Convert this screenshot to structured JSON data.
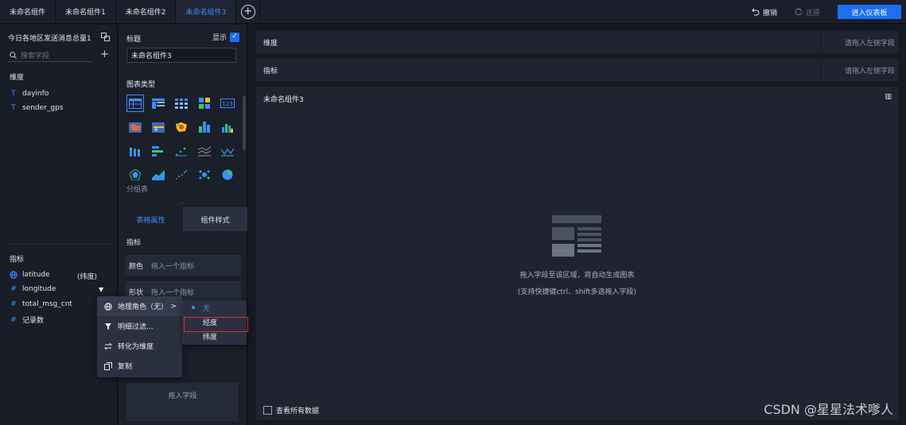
{
  "tabs": [
    {
      "label": "未命名组件"
    },
    {
      "label": "未命名组件1"
    },
    {
      "label": "未命名组件2"
    },
    {
      "label": "未命名组件3"
    }
  ],
  "toolbar": {
    "undo_label": "撤销",
    "redo_label": "还原",
    "enter_dashboard_label": "进入仪表板"
  },
  "left_panel": {
    "dataset_name": "今日各地区发送消息总量1",
    "search_placeholder": "搜索字段",
    "dimensions_title": "维度",
    "dimensions": [
      {
        "icon": "T",
        "name": "dayinfo"
      },
      {
        "icon": "T",
        "name": "sender_gps"
      }
    ],
    "measures_title": "指标",
    "measures": [
      {
        "icon": "globe",
        "name": "latitude",
        "suffix": "(纬度)"
      },
      {
        "icon": "#",
        "name": "longitude"
      },
      {
        "icon": "#",
        "name": "total_msg_cnt"
      },
      {
        "icon": "#",
        "name": "记录数"
      }
    ]
  },
  "middle_panel": {
    "title_label": "标题",
    "show_label": "显示",
    "title_value": "未命名组件3",
    "chart_type_label": "图表类型",
    "selected_chart_caption": "分组表",
    "subtab_table_props": "表格属性",
    "subtab_component_style": "组件样式",
    "measures_label": "指标",
    "color_label": "颜色",
    "color_hint": "拖入一个指标",
    "shape_label": "形状",
    "shape_hint": "拖入一个指标",
    "drop_field_label": "拖入字段"
  },
  "context_menu": {
    "items": [
      {
        "icon": "globe-icon",
        "label": "地理角色（无）"
      },
      {
        "icon": "filter-icon",
        "label": "明细过滤..."
      },
      {
        "icon": "swap-icon",
        "label": "转化为维度"
      },
      {
        "icon": "copy-icon",
        "label": "复制"
      }
    ],
    "submenu": [
      {
        "label": "无"
      },
      {
        "label": "经度"
      },
      {
        "label": "纬度"
      }
    ]
  },
  "canvas": {
    "dimension_slot_label": "维度",
    "dimension_slot_hint": "请拖入左侧字段",
    "measure_slot_label": "指标",
    "measure_slot_hint": "请拖入左侧字段",
    "widget_title": "未命名组件3",
    "empty_line1": "拖入字段至该区域，将自动生成图表",
    "empty_line2": "(支持快捷键ctrl、shift多选拖入字段)",
    "view_all_label": "查看所有数据"
  },
  "watermark": "CSDN @星星法术嗲人",
  "colors": {
    "accent": "#1d6ef0",
    "highlight_box": "#e02a2a",
    "background": "#141821"
  }
}
